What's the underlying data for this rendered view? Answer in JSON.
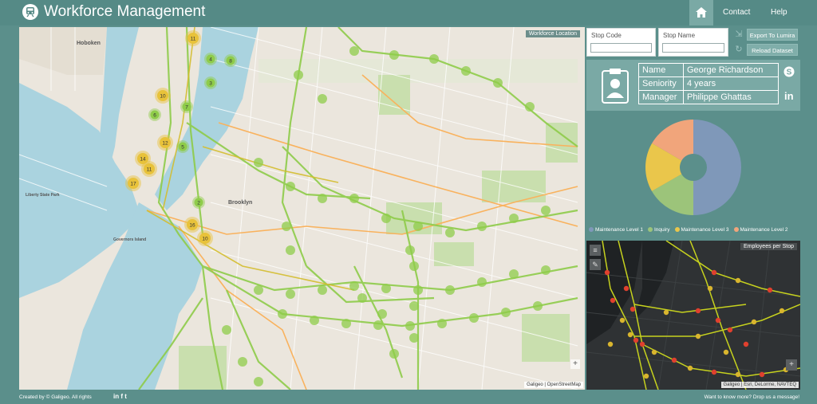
{
  "header": {
    "title": "Workforce Management",
    "nav": [
      {
        "label": "Contact"
      },
      {
        "label": "Help"
      }
    ]
  },
  "main_map": {
    "badge": "Workforce Location",
    "attribution": "Galigeo | OpenStreetMap",
    "zoom_in": "+",
    "districts": [
      "Hoboken",
      "Brooklyn",
      "Governors Island",
      "Liberty State Park"
    ],
    "clusters": [
      {
        "n": "11",
        "level": "hi"
      },
      {
        "n": "4",
        "level": "lo"
      },
      {
        "n": "3",
        "level": "lo"
      },
      {
        "n": "10",
        "level": "hi"
      },
      {
        "n": "7",
        "level": "lo"
      },
      {
        "n": "6",
        "level": "lo"
      },
      {
        "n": "12",
        "level": "hi"
      },
      {
        "n": "5",
        "level": "lo"
      },
      {
        "n": "14",
        "level": "hi"
      },
      {
        "n": "11",
        "level": "hi"
      },
      {
        "n": "17",
        "level": "hi"
      },
      {
        "n": "16",
        "level": "hi"
      },
      {
        "n": "10",
        "level": "hi"
      },
      {
        "n": "2",
        "level": "lo"
      },
      {
        "n": "8",
        "level": "lo"
      }
    ]
  },
  "search": {
    "stop_code_label": "Stop Code",
    "stop_name_label": "Stop Name",
    "stop_code_value": "",
    "stop_name_value": ""
  },
  "buttons": {
    "export": "Export To Lumira",
    "reload": "Reload Dataset"
  },
  "profile": {
    "rows": [
      {
        "key": "Name",
        "value": "George Richardson"
      },
      {
        "key": "Seniority",
        "value": "4 years"
      },
      {
        "key": "Manager",
        "value": "Philippe Ghattas"
      }
    ]
  },
  "chart_data": {
    "type": "pie",
    "title": "",
    "labels": [
      "Maintenance Level 1",
      "Inquiry",
      "Maintenance Level 3",
      "Maintenance Level 2"
    ],
    "values": [
      50,
      16.7,
      16.7,
      16.6
    ],
    "colors": [
      "#7f98b9",
      "#9cc47a",
      "#eac64b",
      "#f1a57b"
    ],
    "legend_position": "bottom"
  },
  "dark_map": {
    "badge": "Employees per Stop",
    "attribution": "Galigeo | Esri, DeLorme, NAVTEQ",
    "zoom_in": "+"
  },
  "footer": {
    "left": "Created by © Galigeo. All rights",
    "social": "in f t",
    "right": "Want to know more? Drop us a message!"
  },
  "colors": {
    "accent": "#5b8f8b",
    "cluster_lo": "#8fcc4a",
    "cluster_hi": "#e8c23a",
    "dark_dot_hi": "#e0402e",
    "dark_dot_lo": "#d9b52e"
  }
}
